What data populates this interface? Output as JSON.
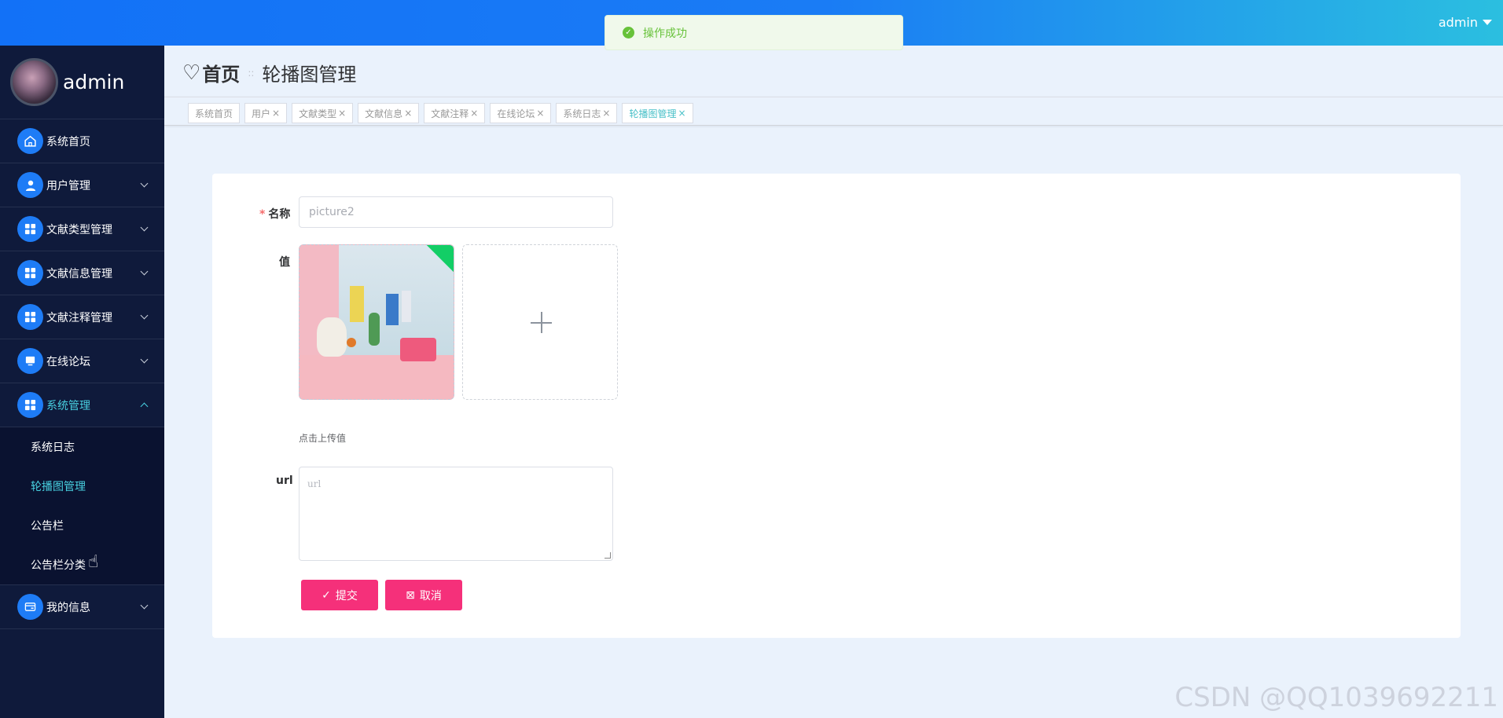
{
  "header": {
    "user": "admin"
  },
  "toast": {
    "message": "操作成功"
  },
  "sidebar": {
    "profile_name": "admin",
    "items": [
      {
        "label": "系统首页",
        "icon": "home-icon",
        "expandable": false
      },
      {
        "label": "用户管理",
        "icon": "user-icon",
        "expandable": true
      },
      {
        "label": "文献类型管理",
        "icon": "grid-icon",
        "expandable": true
      },
      {
        "label": "文献信息管理",
        "icon": "grid-icon",
        "expandable": true
      },
      {
        "label": "文献注释管理",
        "icon": "grid-icon",
        "expandable": true
      },
      {
        "label": "在线论坛",
        "icon": "monitor-icon",
        "expandable": true
      },
      {
        "label": "系统管理",
        "icon": "grid-icon",
        "expandable": true,
        "expanded": true
      },
      {
        "label": "我的信息",
        "icon": "card-icon",
        "expandable": true
      }
    ],
    "submenu": [
      "系统日志",
      "轮播图管理",
      "公告栏",
      "公告栏分类"
    ]
  },
  "breadcrumb": {
    "home": "首页",
    "separator": "::",
    "current": "轮播图管理"
  },
  "tags": [
    "系统首页",
    "用户",
    "文献类型",
    "文献信息",
    "文献注释",
    "在线论坛",
    "系统日志",
    "轮播图管理"
  ],
  "form": {
    "name_label": "名称",
    "name_value": "picture2",
    "value_label": "值",
    "upload_tip": "点击上传值",
    "url_label": "url",
    "url_placeholder": "url",
    "submit": "提交",
    "cancel": "取消"
  },
  "watermark": "CSDN @QQ1039692211",
  "colors": {
    "accent": "#1e7cf6",
    "active_text": "#48d0e0",
    "button": "#f5307a",
    "success": "#67c23a"
  }
}
